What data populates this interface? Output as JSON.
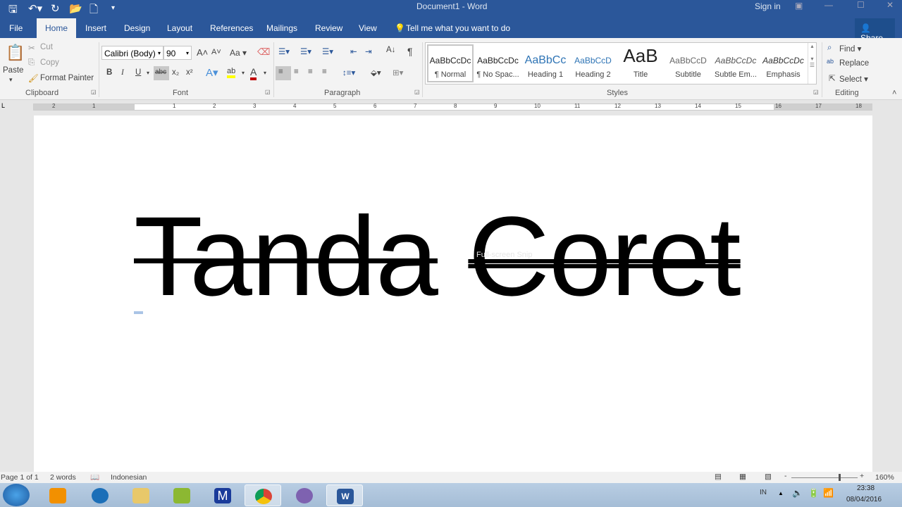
{
  "window": {
    "title": "Document1 - Word",
    "sign_in": "Sign in"
  },
  "quick_access": {
    "icons": [
      "save-icon",
      "undo-icon",
      "redo-icon",
      "open-icon",
      "print-preview-icon",
      "customize-icon"
    ]
  },
  "tabs": [
    "File",
    "Home",
    "Insert",
    "Design",
    "Layout",
    "References",
    "Mailings",
    "Review",
    "View"
  ],
  "active_tab": "Home",
  "tell_me": "Tell me what you want to do",
  "share": "Share",
  "clipboard": {
    "paste": "Paste",
    "cut": "Cut",
    "copy": "Copy",
    "format_painter": "Format Painter",
    "label": "Clipboard"
  },
  "font": {
    "name": "Calibri (Body)",
    "size": "90",
    "change_case": "Aa",
    "label": "Font",
    "buttons": [
      "B",
      "I",
      "U",
      "abc",
      "x₂",
      "x²"
    ],
    "highlight_color": "#ffff00",
    "font_color": "#c00000"
  },
  "paragraph": {
    "label": "Paragraph",
    "pilcrow": "¶"
  },
  "styles": {
    "label": "Styles",
    "items": [
      {
        "preview": "AaBbCcDc",
        "name": "¶ Normal",
        "color": "#222222"
      },
      {
        "preview": "AaBbCcDc",
        "name": "¶ No Spac...",
        "color": "#222222"
      },
      {
        "preview": "AaBbCc",
        "name": "Heading 1",
        "color": "#2e74b5"
      },
      {
        "preview": "AaBbCcD",
        "name": "Heading 2",
        "color": "#2e74b5"
      },
      {
        "preview": "AaB",
        "name": "Title",
        "color": "#222222"
      },
      {
        "preview": "AaBbCcD",
        "name": "Subtitle",
        "color": "#666666"
      },
      {
        "preview": "AaBbCcDc",
        "name": "Subtle Em...",
        "color": "#555555"
      },
      {
        "preview": "AaBbCcDc",
        "name": "Emphasis",
        "color": "#333333"
      }
    ]
  },
  "editing": {
    "find": "Find",
    "replace": "Replace",
    "select": "Select",
    "label": "Editing"
  },
  "ruler": {
    "numbers": [
      "2",
      "1",
      "1",
      "2",
      "3",
      "4",
      "5",
      "6",
      "7",
      "8",
      "9",
      "10",
      "11",
      "12",
      "13",
      "14",
      "15",
      "16",
      "17",
      "18"
    ]
  },
  "document": {
    "word1": "Tanda",
    "word2": "Coret",
    "overlay": "Full-screen Snip"
  },
  "status": {
    "page": "Page 1 of 1",
    "words": "2 words",
    "language": "Indonesian",
    "zoom": "160%",
    "zoom_level": 160
  },
  "taskbar": {
    "apps": [
      "start",
      "media-player",
      "firefox",
      "file-explorer",
      "app-tv",
      "app-m",
      "chrome",
      "app-purple",
      "word"
    ],
    "m_label": "M",
    "lang": "IN",
    "time": "23:38",
    "date": "08/04/2016"
  },
  "colors": {
    "accent": "#2b579a"
  }
}
